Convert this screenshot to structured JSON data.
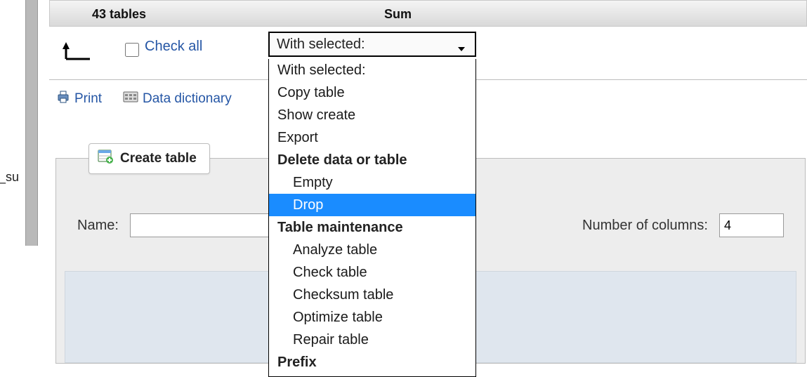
{
  "summary": {
    "tables_label": "43 tables",
    "sum_label": "Sum"
  },
  "actions": {
    "check_all_label": "Check all",
    "select_display": "With selected:"
  },
  "dropdown": {
    "placeholder": "With selected:",
    "copy": "Copy table",
    "show_create": "Show create",
    "export": "Export",
    "group_delete": "Delete data or table",
    "empty": "Empty",
    "drop": "Drop",
    "group_maint": "Table maintenance",
    "analyze": "Analyze table",
    "check": "Check table",
    "checksum": "Checksum table",
    "optimize": "Optimize table",
    "repair": "Repair table",
    "group_prefix": "Prefix",
    "highlighted": "drop"
  },
  "toolbar": {
    "print": "Print",
    "data_dictionary": "Data dictionary"
  },
  "create": {
    "legend": "Create table",
    "name_label": "Name:",
    "name_value": "",
    "cols_label": "Number of columns:",
    "cols_value": "4"
  },
  "left_edge_text": "_su"
}
